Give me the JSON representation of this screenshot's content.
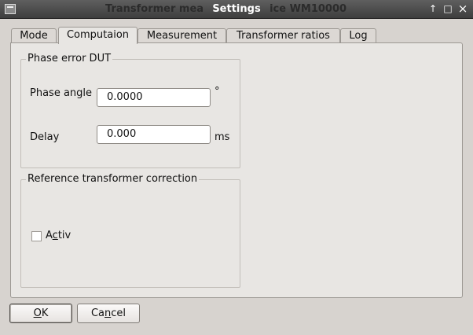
{
  "window": {
    "title": "Settings",
    "background_title": "Transformer mea",
    "background_title_tail": "ice WM10000",
    "buttons": {
      "up": "↑",
      "maximize": "□",
      "close": "×"
    }
  },
  "tabs": [
    {
      "label": "Mode",
      "active": false
    },
    {
      "label": "Computaion",
      "active": true
    },
    {
      "label": "Measurement",
      "active": false
    },
    {
      "label": "Transformer ratios",
      "active": false
    },
    {
      "label": "Log",
      "active": false
    }
  ],
  "phase_error": {
    "title": "Phase error DUT",
    "phase_angle_label": "Phase angle",
    "phase_angle_value": "0.0000",
    "phase_angle_unit": "°",
    "delay_label": "Delay",
    "delay_value": "0.000",
    "delay_unit": "ms"
  },
  "reference": {
    "title": "Reference transformer correction",
    "activ_label_prefix": "A",
    "activ_label_mnemonic": "c",
    "activ_label_suffix": "tiv",
    "activ_checked": false
  },
  "buttons": {
    "ok_mnemonic": "O",
    "ok_rest": "K",
    "cancel_prefix": "Ca",
    "cancel_mnemonic": "n",
    "cancel_suffix": "cel"
  },
  "colors": {
    "titlebar": "#4a4a4a",
    "window_bg": "#d7d3cf",
    "panel_bg": "#e8e6e3"
  }
}
